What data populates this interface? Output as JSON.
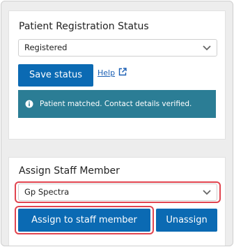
{
  "registration": {
    "title": "Patient Registration Status",
    "selected": "Registered",
    "save_label": "Save status",
    "help_label": "Help",
    "alert_text": "Patient matched. Contact details verified."
  },
  "staff": {
    "title": "Assign Staff Member",
    "selected": "Gp Spectra",
    "assign_label": "Assign to staff member",
    "unassign_label": "Unassign"
  },
  "colors": {
    "primary": "#0b6ab3",
    "alert_bg": "#2b7d95",
    "highlight": "#e1444f",
    "link": "#1a5fb4"
  },
  "icons": {
    "chevron": "chevron-down-icon",
    "external": "external-link-icon",
    "info": "info-icon"
  }
}
